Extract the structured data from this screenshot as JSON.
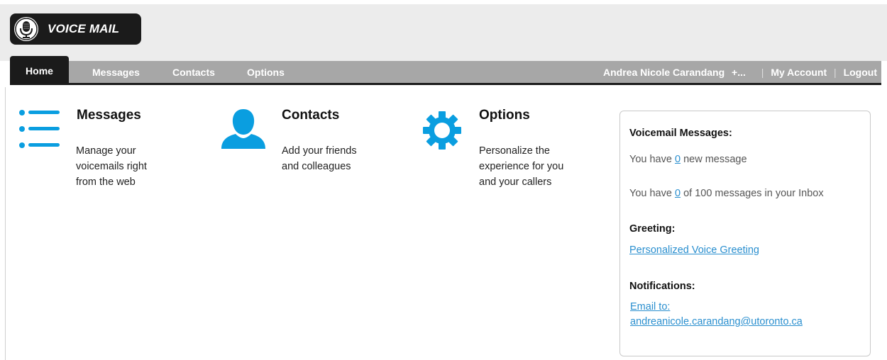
{
  "header": {
    "brand": "VOICE MAIL",
    "logo_icon": "microphone-icon"
  },
  "nav": {
    "home": "Home",
    "messages": "Messages",
    "contacts": "Contacts",
    "options": "Options",
    "user": "Andrea Nicole Carandang",
    "user_more": "+...",
    "separator": "|",
    "my_account": "My Account",
    "logout": "Logout"
  },
  "features": [
    {
      "icon": "list-icon",
      "title": "Messages",
      "desc_lines": [
        "Manage your",
        "voicemails right",
        "from the web"
      ]
    },
    {
      "icon": "person-icon",
      "title": "Contacts",
      "desc_lines": [
        "Add your friends",
        "and colleagues"
      ]
    },
    {
      "icon": "gear-icon",
      "title": "Options",
      "desc_lines": [
        "Personalize the",
        "experience for you",
        "and your callers"
      ]
    }
  ],
  "panel": {
    "voicemail_heading": "Voicemail Messages:",
    "new_prefix": "You have",
    "new_count": "0",
    "new_suffix": "new message",
    "inbox_prefix": "You have",
    "inbox_count": "0",
    "inbox_suffix": "of 100 messages in your Inbox",
    "greeting_heading": "Greeting:",
    "greeting_link": "Personalized Voice Greeting",
    "notifications_heading": "Notifications:",
    "email_label": "Email to:",
    "email_address": "andreanicole.carandang@utoronto.ca"
  },
  "colors": {
    "accent_blue": "#0a9ee0",
    "link_blue": "#2a8fcf",
    "nav_gray": "#a7a7a7",
    "nav_dark": "#1b1b1b"
  }
}
